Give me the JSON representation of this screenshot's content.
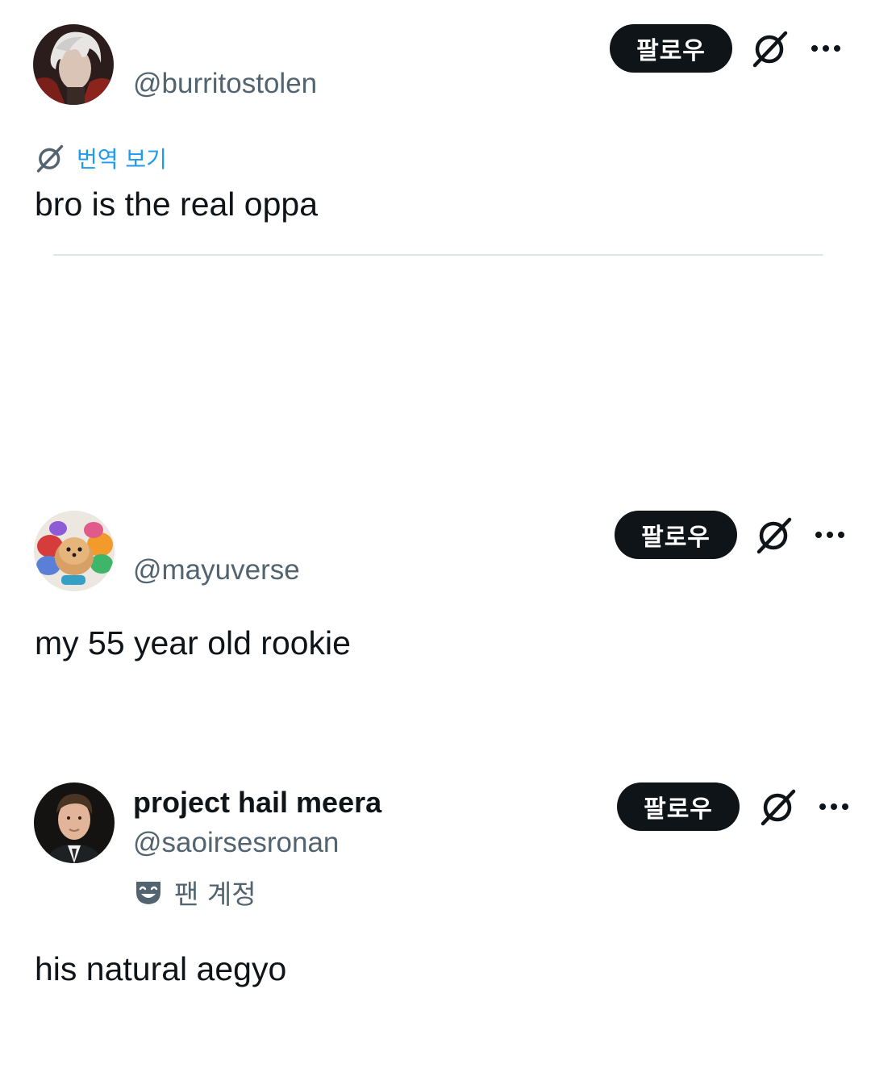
{
  "posts": [
    {
      "handle": "@burritostolen",
      "follow_label": "팔로우",
      "translate_label": "번역 보기",
      "text": "bro is the real oppa"
    },
    {
      "handle": "@mayuverse",
      "follow_label": "팔로우",
      "text": "my 55 year old rookie"
    },
    {
      "display_name": "project hail meera",
      "handle": "@saoirsesronan",
      "follow_label": "팔로우",
      "badge_label": "팬 계정",
      "text": "his natural aegyo"
    }
  ],
  "icons": {
    "grok": "grok-icon",
    "more": "more-icon",
    "fan_mask": "theater-mask-icon"
  },
  "colors": {
    "text": "#0f1419",
    "secondary": "#536471",
    "link": "#1d9bf0",
    "button_bg": "#0f1419",
    "button_text": "#ffffff",
    "divider": "#dfe5e8"
  }
}
